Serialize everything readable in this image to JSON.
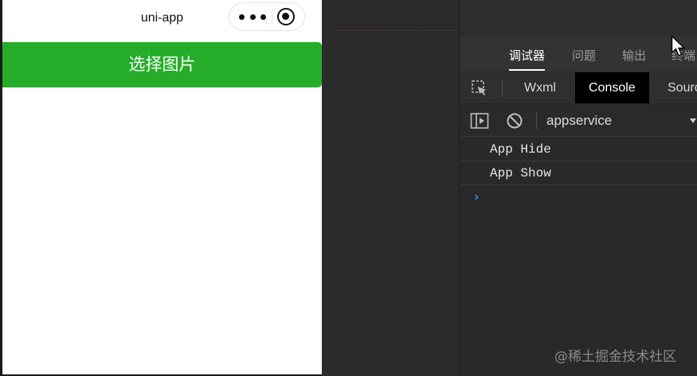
{
  "simulator": {
    "nav_title": "uni-app",
    "pick_button_label": "选择图片",
    "button_color": "#25ad2a"
  },
  "devtools": {
    "top_tabs": [
      {
        "label": "调试器",
        "active": true
      },
      {
        "label": "问题",
        "active": false
      },
      {
        "label": "输出",
        "active": false
      },
      {
        "label": "终端",
        "active": false
      }
    ],
    "panel_tabs": [
      {
        "label": "Wxml",
        "active": false
      },
      {
        "label": "Console",
        "active": true
      },
      {
        "label": "Sources",
        "active": false
      }
    ],
    "context": "appservice",
    "logs": [
      "App Hide",
      "App Show"
    ],
    "prompt_symbol": "›",
    "accent_color": "#3b8eea"
  },
  "icons": {
    "capsule_menu": "more-dots-icon",
    "capsule_close": "target-circle-icon",
    "inspect": "inspect-cursor-icon",
    "sidebar_toggle": "play-panel-icon",
    "clear": "block-icon"
  },
  "watermark": "@稀土掘金技术社区"
}
